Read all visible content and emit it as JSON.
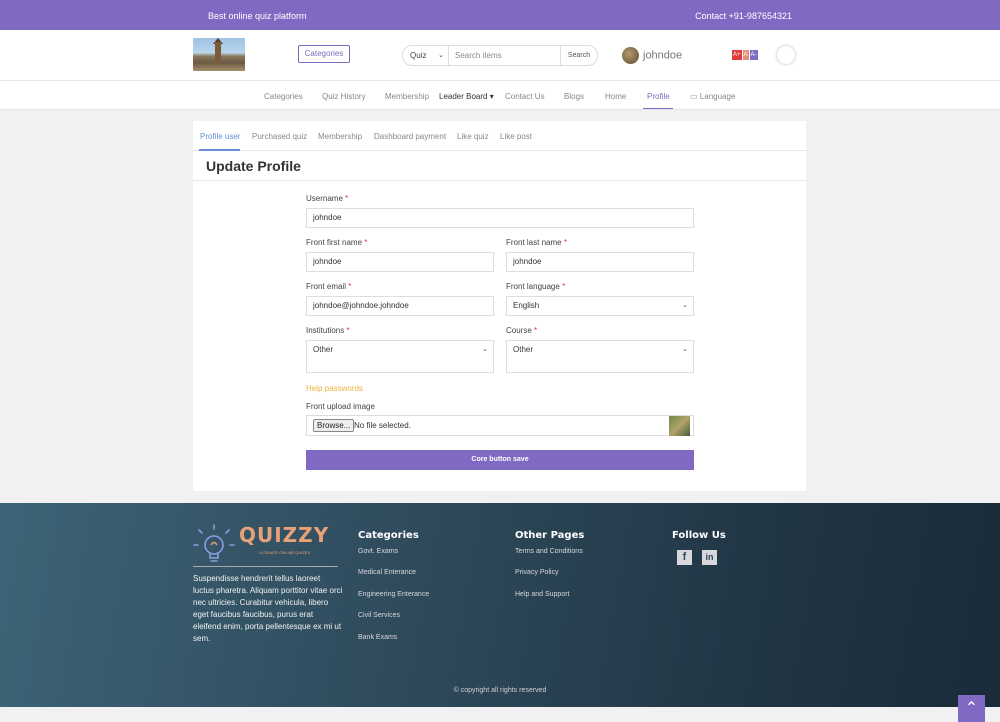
{
  "topbar": {
    "tagline": "Best online quiz platform",
    "contact": "Contact +91-987654321"
  },
  "header": {
    "categories_btn": "Categories",
    "search": {
      "type": "Quiz",
      "placeholder": "Search items",
      "button": "Search"
    },
    "user": "johndoe",
    "font_sizes": [
      "A+",
      "A",
      "A-"
    ]
  },
  "nav": {
    "items": [
      "Categories",
      "Quiz History",
      "Membership",
      "Leader Board",
      "Contact Us",
      "Blogs",
      "Home",
      "Profile",
      "Language"
    ],
    "active": "Profile"
  },
  "tabs": [
    "Profile user",
    "Purchased quiz",
    "Membership",
    "Dashboard payment",
    "Like quiz",
    "Like post"
  ],
  "form": {
    "title": "Update Profile",
    "username_label": "Username",
    "username": "johndoe",
    "first_name_label": "Front first name",
    "first_name": "johndoe",
    "last_name_label": "Front last name",
    "last_name": "johndoe",
    "email_label": "Front email",
    "email": "johndoe@johndoe.johndoe",
    "language_label": "Front language",
    "language": "English",
    "institutions_label": "Institutions",
    "institutions": "Other",
    "course_label": "Course",
    "course": "Other",
    "help_passwords": "Help passwords",
    "upload_label": "Front upload image",
    "browse": "Browse...",
    "no_file": "No file selected.",
    "save": "Core button save",
    "required_mark": "*"
  },
  "footer": {
    "brand": "QUIZZY",
    "brand_sub": "ULTIMATE ONLINE QUIZES",
    "about": "Suspendisse hendrerit tellus laoreet luctus pharetra. Aliquam porttitor vitae orci nec ultricies. Curabitur vehicula, libero eget faucibus faucibus, purus erat eleifend enim, porta pellentesque ex mi ut sem.",
    "categories_title": "Categories",
    "categories": [
      "Govt. Exams",
      "Medical Enterance",
      "Engineering Enterance",
      "Civil Services",
      "Bank Exams"
    ],
    "other_title": "Other Pages",
    "other": [
      "Terms and Conditions",
      "Privacy Policy",
      "Help and Support"
    ],
    "follow_title": "Follow Us",
    "copyright": "© copyright all rights reserved"
  },
  "colors": {
    "accent": "#8069c2",
    "tab_active": "#6a8fd8",
    "help": "#e8b437",
    "required": "#d33333"
  }
}
